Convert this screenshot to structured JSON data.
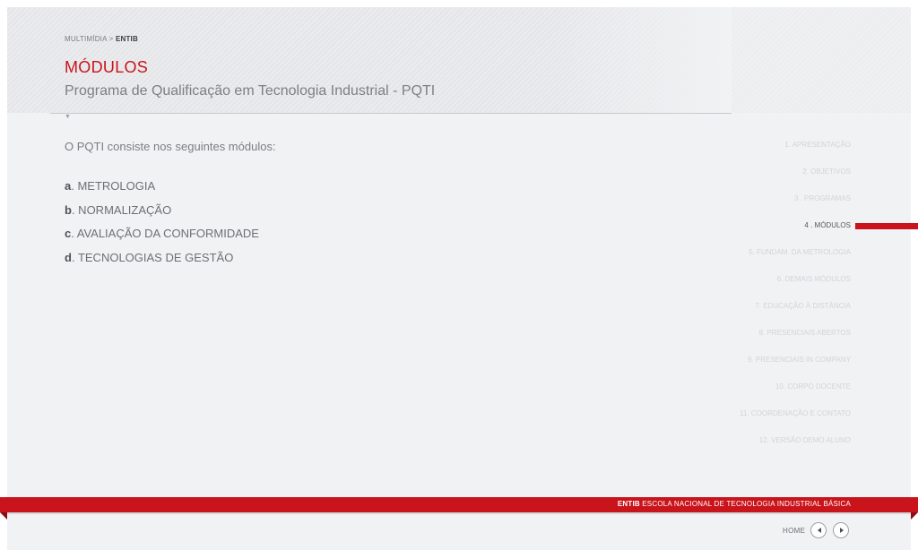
{
  "breadcrumb": {
    "section": "MULTIMÍDIA",
    "separator": ">",
    "current": "ENTIB"
  },
  "page": {
    "title": "MÓDULOS",
    "subtitle": "Programa de Qualificação em Tecnologia Industrial - PQTI",
    "intro": "O PQTI consiste nos seguintes módulos:"
  },
  "modules": [
    {
      "letter": "a",
      "label": ". METROLOGIA"
    },
    {
      "letter": "b",
      "label": ". NORMALIZAÇÃO"
    },
    {
      "letter": "c",
      "label": ". AVALIAÇÃO DA CONFORMIDADE"
    },
    {
      "letter": "d",
      "label": ". TECNOLOGIAS DE GESTÃO"
    }
  ],
  "sidebar_nav": [
    {
      "label": "1. APRESENTAÇÃO"
    },
    {
      "label": "2. OBJETIVOS"
    },
    {
      "label": "3 . PROGRAMAS"
    },
    {
      "label": "4 . MÓDULOS",
      "active": true
    },
    {
      "label": "5. FUNDAM. DA METROLOGIA"
    },
    {
      "label": "6. DEMAIS MÓDULOS"
    },
    {
      "label": "7. EDUCAÇÃO À DISTÂNCIA"
    },
    {
      "label": "8. PRESENCIAIS ABERTOS"
    },
    {
      "label": "9. PRESENCIAIS IN COMPANY"
    },
    {
      "label": "10. CORPO DOCENTE"
    },
    {
      "label": "11. COORDENAÇÃO E CONTATO"
    },
    {
      "label": "12. VERSÃO DEMO ALUNO"
    }
  ],
  "footer": {
    "brand": "ENTIB",
    "text": " ESCOLA NACIONAL DE TECNOLOGIA INDUSTRIAL BÁSICA"
  },
  "bottom_nav": {
    "home_label": "HOME",
    "prev_icon": "arrow-left-icon",
    "next_icon": "arrow-right-icon"
  },
  "colors": {
    "accent": "#c9141c",
    "background": "#f1f2f4"
  }
}
